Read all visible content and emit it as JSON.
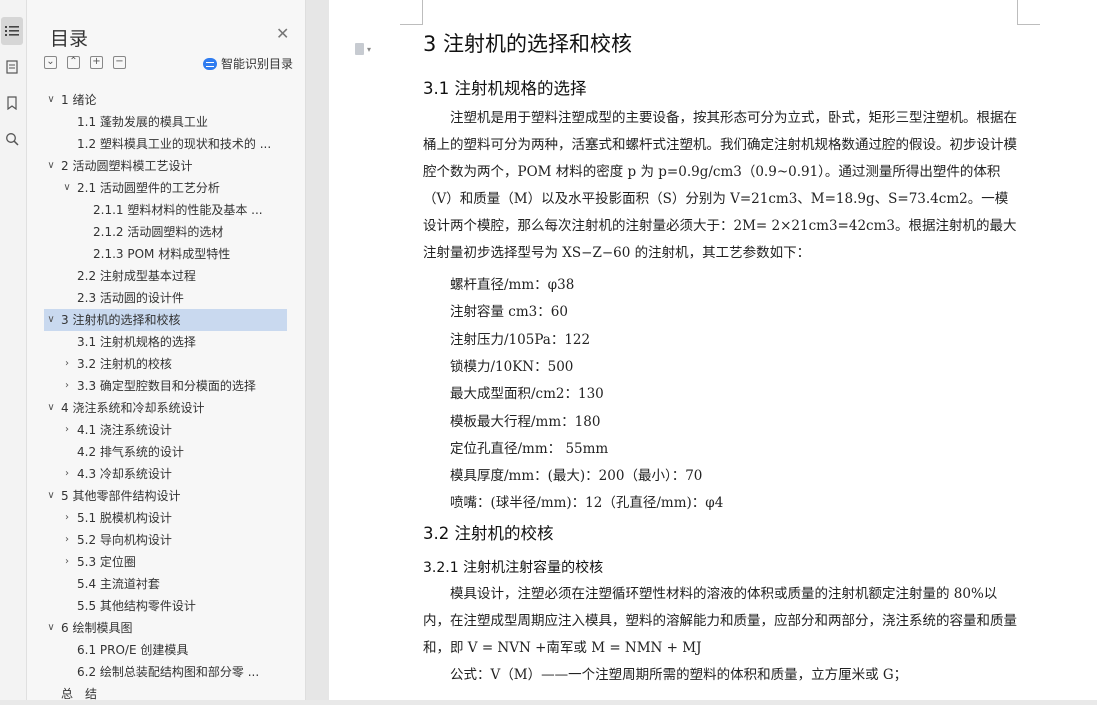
{
  "toc": {
    "title": "目录",
    "smart_label": "智能识别目录",
    "items": [
      {
        "label": "1 绪论",
        "level": 1,
        "arrow": "down"
      },
      {
        "label": "1.1 蓬勃发展的模具工业",
        "level": 2,
        "arrow": ""
      },
      {
        "label": "1.2 塑料模具工业的现状和技术的 ...",
        "level": 2,
        "arrow": ""
      },
      {
        "label": "2 活动圆塑料模工艺设计",
        "level": 1,
        "arrow": "down"
      },
      {
        "label": "2.1 活动圆塑件的工艺分析",
        "level": 2,
        "arrow": "down"
      },
      {
        "label": "2.1.1 塑料材料的性能及基本 ...",
        "level": 3,
        "arrow": ""
      },
      {
        "label": "2.1.2 活动圆塑料的选材",
        "level": 3,
        "arrow": ""
      },
      {
        "label": "2.1.3 POM 材料成型特性",
        "level": 3,
        "arrow": ""
      },
      {
        "label": "2.2 注射成型基本过程",
        "level": 2,
        "arrow": ""
      },
      {
        "label": "2.3 活动圆的设计件",
        "level": 2,
        "arrow": ""
      },
      {
        "label": "3 注射机的选择和校核",
        "level": 1,
        "arrow": "down",
        "selected": true
      },
      {
        "label": "3.1 注射机规格的选择",
        "level": 2,
        "arrow": ""
      },
      {
        "label": "3.2 注射机的校核",
        "level": 2,
        "arrow": "right"
      },
      {
        "label": "3.3 确定型腔数目和分模面的选择",
        "level": 2,
        "arrow": "right"
      },
      {
        "label": "4 浇注系统和冷却系统设计",
        "level": 1,
        "arrow": "down"
      },
      {
        "label": "4.1 浇注系统设计",
        "level": 2,
        "arrow": "right"
      },
      {
        "label": "4.2 排气系统的设计",
        "level": 2,
        "arrow": ""
      },
      {
        "label": "4.3 冷却系统设计",
        "level": 2,
        "arrow": "right"
      },
      {
        "label": "5 其他零部件结构设计",
        "level": 1,
        "arrow": "down"
      },
      {
        "label": "5.1 脱模机构设计",
        "level": 2,
        "arrow": "right"
      },
      {
        "label": "5.2 导向机构设计",
        "level": 2,
        "arrow": "right"
      },
      {
        "label": "5.3 定位圈",
        "level": 2,
        "arrow": "right"
      },
      {
        "label": "5.4 主流道衬套",
        "level": 2,
        "arrow": ""
      },
      {
        "label": "5.5 其他结构零件设计",
        "level": 2,
        "arrow": ""
      },
      {
        "label": "6 绘制模具图",
        "level": 1,
        "arrow": "down"
      },
      {
        "label": "6.1 PRO/E 创建模具",
        "level": 2,
        "arrow": ""
      },
      {
        "label": "6.2 绘制总装配结构图和部分零 ...",
        "level": 2,
        "arrow": ""
      },
      {
        "label": "总　结",
        "level": 1,
        "arrow": ""
      }
    ]
  },
  "document": {
    "h1": "3 注射机的选择和校核",
    "h2_1": "3.1 注射机规格的选择",
    "para1": "注塑机是用于塑料注塑成型的主要设备，按其形态可分为立式，卧式，矩形三型注塑机。根据在桶上的塑料可分为两种，活塞式和螺杆式注塑机。我们确定注射机规格数通过腔的假设。初步设计模腔个数为两个，POM 材料的密度 p 为 p=0.9g/cm3（0.9~0.91）。通过测量所得出塑件的体积（V）和质量（M）以及水平投影面积（S）分别为 V=21cm3、M=18.9g、S=73.4cm2。一模设计两个模腔，那么每次注射机的注射量必须大于：2M= 2×21cm3=42cm3。根据注射机的最大注射量初步选择型号为 XS−Z−60 的注射机，其工艺参数如下：",
    "params": [
      "螺杆直径/mm：φ38",
      "注射容量 cm3：60",
      "注射压力/105Pa：122",
      "锁模力/10KN：500",
      "最大成型面积/cm2：130",
      "模板最大行程/mm：180",
      "定位孔直径/mm：  55mm",
      "模具厚度/mm：(最大)：200（最小）：70",
      "喷嘴：(球半径/mm)：12（孔直径/mm)：φ4"
    ],
    "h2_2": "3.2 注射机的校核",
    "h3_1": "3.2.1 注射机注射容量的校核",
    "para2": "模具设计，注塑必须在注塑循环塑性材料的溶液的体积或质量的注射机额定注射量的 80%以内，在注塑成型周期应注入模具，塑料的溶解能力和质量，应部分和两部分，浇注系统的容量和质量和，即 V = NVN +南军或 M = NMN + MJ",
    "para3": "公式：V（M）——一个注塑周期所需的塑料的体积和质量，立方厘米或 G；"
  }
}
